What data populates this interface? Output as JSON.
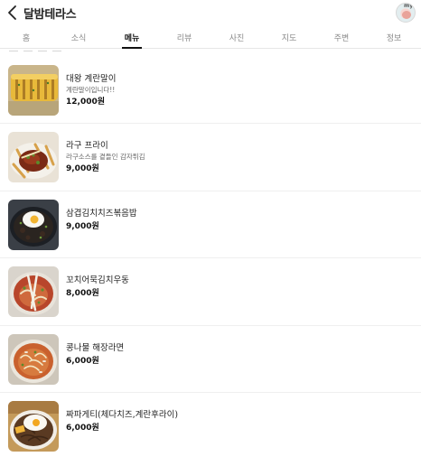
{
  "header": {
    "title": "달밤테라스",
    "back_icon": "chevron-left-icon",
    "profile_tag": "my"
  },
  "tabs": [
    {
      "label": "홈",
      "active": false
    },
    {
      "label": "소식",
      "active": false
    },
    {
      "label": "메뉴",
      "active": true
    },
    {
      "label": "리뷰",
      "active": false
    },
    {
      "label": "사진",
      "active": false
    },
    {
      "label": "지도",
      "active": false
    },
    {
      "label": "주변",
      "active": false
    },
    {
      "label": "정보",
      "active": false
    }
  ],
  "menu": [
    {
      "name": "대왕 계란말이",
      "description": "계란말이입니다!!",
      "price": "12,000원"
    },
    {
      "name": "라구 프라이",
      "description": "라구소스를 곁들인 감자튀김",
      "price": "9,000원"
    },
    {
      "name": "삼겹김치치즈볶음밥",
      "description": "",
      "price": "9,000원"
    },
    {
      "name": "꼬치어묵김치우동",
      "description": "",
      "price": "8,000원"
    },
    {
      "name": "콩나물 해장라면",
      "description": "",
      "price": "6,000원"
    },
    {
      "name": "짜파게티(체다치즈,계란후라이)",
      "description": "",
      "price": "6,000원"
    }
  ],
  "colors": {
    "text": "#222222",
    "muted": "#8a8a8a",
    "divider": "#efefef"
  }
}
